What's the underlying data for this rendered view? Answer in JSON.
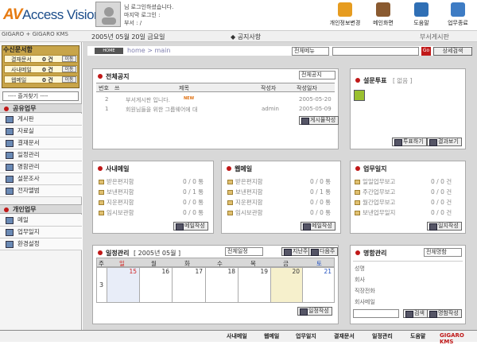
{
  "header": {
    "logo_prefix": "AV",
    "logo_text": "Access Vision",
    "user_greeting": "님 로그인하셨습니다.",
    "last_login": "마지막 로그인 :",
    "dept_line": "부서 : /",
    "top_buttons": [
      {
        "label": "개인정보변경",
        "icon": "person-card-icon",
        "color": "#e69c20"
      },
      {
        "label": "메인화면",
        "icon": "home-icon",
        "color": "#8a5a30"
      },
      {
        "label": "도움말",
        "icon": "help-icon",
        "color": "#2f6fb5"
      },
      {
        "label": "업무종료",
        "icon": "exit-icon",
        "color": "#3e7cc4"
      }
    ]
  },
  "subbar": {
    "brand": "GIGARO",
    "brand_suffix": "+ GIGARO KMS",
    "date": "2005년 05월 20일 금요일",
    "notice": "◆ 공지사항",
    "dept": "부서게시판"
  },
  "sidebar": {
    "approval_title": "수신문서함",
    "approval_rows": [
      {
        "label": "결재문서",
        "count": "0 건",
        "btn": "이동"
      },
      {
        "label": "사내메일",
        "count": "0 건",
        "btn": "이동"
      },
      {
        "label": "웹메일",
        "count": "0 건",
        "btn": "이동"
      }
    ],
    "favorites": "---- 즐겨찾기 ----",
    "section1": "공유업무",
    "section1_items": [
      "게시판",
      "자료실",
      "결재문서",
      "일정관리",
      "명함관리",
      "설문조사",
      "전자앨범"
    ],
    "section2": "개인업무",
    "section2_items": [
      "메일",
      "업무일지",
      "환경설정"
    ]
  },
  "toolbar": {
    "home_badge": "HOME",
    "breadcrumb": "home > main",
    "allmenu": "전체메뉴",
    "search_placeholder": "",
    "go": "Go",
    "detail_search": "상세검색"
  },
  "notice_panel": {
    "title": "전체공지",
    "filter": "전체공지",
    "columns": [
      "번호",
      "쓰",
      "제목",
      "작성자",
      "작성일자"
    ],
    "rows": [
      {
        "no": "2",
        "title": "부서게시판 입니다.",
        "badge": "NEW",
        "author": "",
        "date": "2005-05-20"
      },
      {
        "no": "1",
        "title": "회원님들을 위한 그룹웨어에 대",
        "badge": "",
        "author": "admin",
        "date": "2005-05-09"
      }
    ],
    "write_btn": "게시물작성"
  },
  "survey_panel": {
    "title": "설문투표",
    "status": "[ 없음 ]",
    "vote_btn": "투표하기",
    "result_btn": "결과보기"
  },
  "mail_panel": {
    "title": "사내메일",
    "rows": [
      {
        "label": "받은편지함",
        "value": "0 / 0 통"
      },
      {
        "label": "보낸편지함",
        "value": "0 / 1 통"
      },
      {
        "label": "지운편지함",
        "value": "0 / 0 통"
      },
      {
        "label": "임시보관함",
        "value": "0 / 0 통"
      }
    ],
    "btn": "메일작성"
  },
  "webmail_panel": {
    "title": "웹메일",
    "rows": [
      {
        "label": "받은편지함",
        "value": "0 / 0 통"
      },
      {
        "label": "보낸편지함",
        "value": "0 / 1 통"
      },
      {
        "label": "지운편지함",
        "value": "0 / 0 통"
      },
      {
        "label": "임시보관함",
        "value": "0 / 0 통"
      }
    ],
    "btn": "메일작성"
  },
  "journal_panel": {
    "title": "업무일지",
    "rows": [
      {
        "label": "일일업무보고",
        "value": "0 / 0 건"
      },
      {
        "label": "주간업무보고",
        "value": "0 / 0 건"
      },
      {
        "label": "월간업무보고",
        "value": "0 / 0 건"
      },
      {
        "label": "보낸업무일지",
        "value": "0 / 0 건"
      }
    ],
    "btn": "일지작성"
  },
  "calendar_panel": {
    "title": "일정관리",
    "period": "[ 2005년 05월 ]",
    "filter": "전체일정",
    "prev": "지난주",
    "next": "다음주",
    "headers": [
      "주",
      "일",
      "월",
      "화",
      "수",
      "목",
      "금",
      "토"
    ],
    "week": "3",
    "days": [
      "15",
      "16",
      "17",
      "18",
      "19",
      "20",
      "21"
    ],
    "btn": "일정작성",
    "header_colors": {
      "sun": "#d02020",
      "sat": "#2050c0"
    }
  },
  "card_panel": {
    "title": "명함관리",
    "filter": "전체명함",
    "fields": [
      "성명",
      "회사",
      "직장전화",
      "회사메일"
    ],
    "search_btn": "검색",
    "register_btn": "명함작성"
  },
  "bottom": {
    "items": [
      "사내메일",
      "웹메일",
      "업무일지",
      "결재문서",
      "일정관리",
      "도움말",
      "GIGARO KMS"
    ]
  }
}
